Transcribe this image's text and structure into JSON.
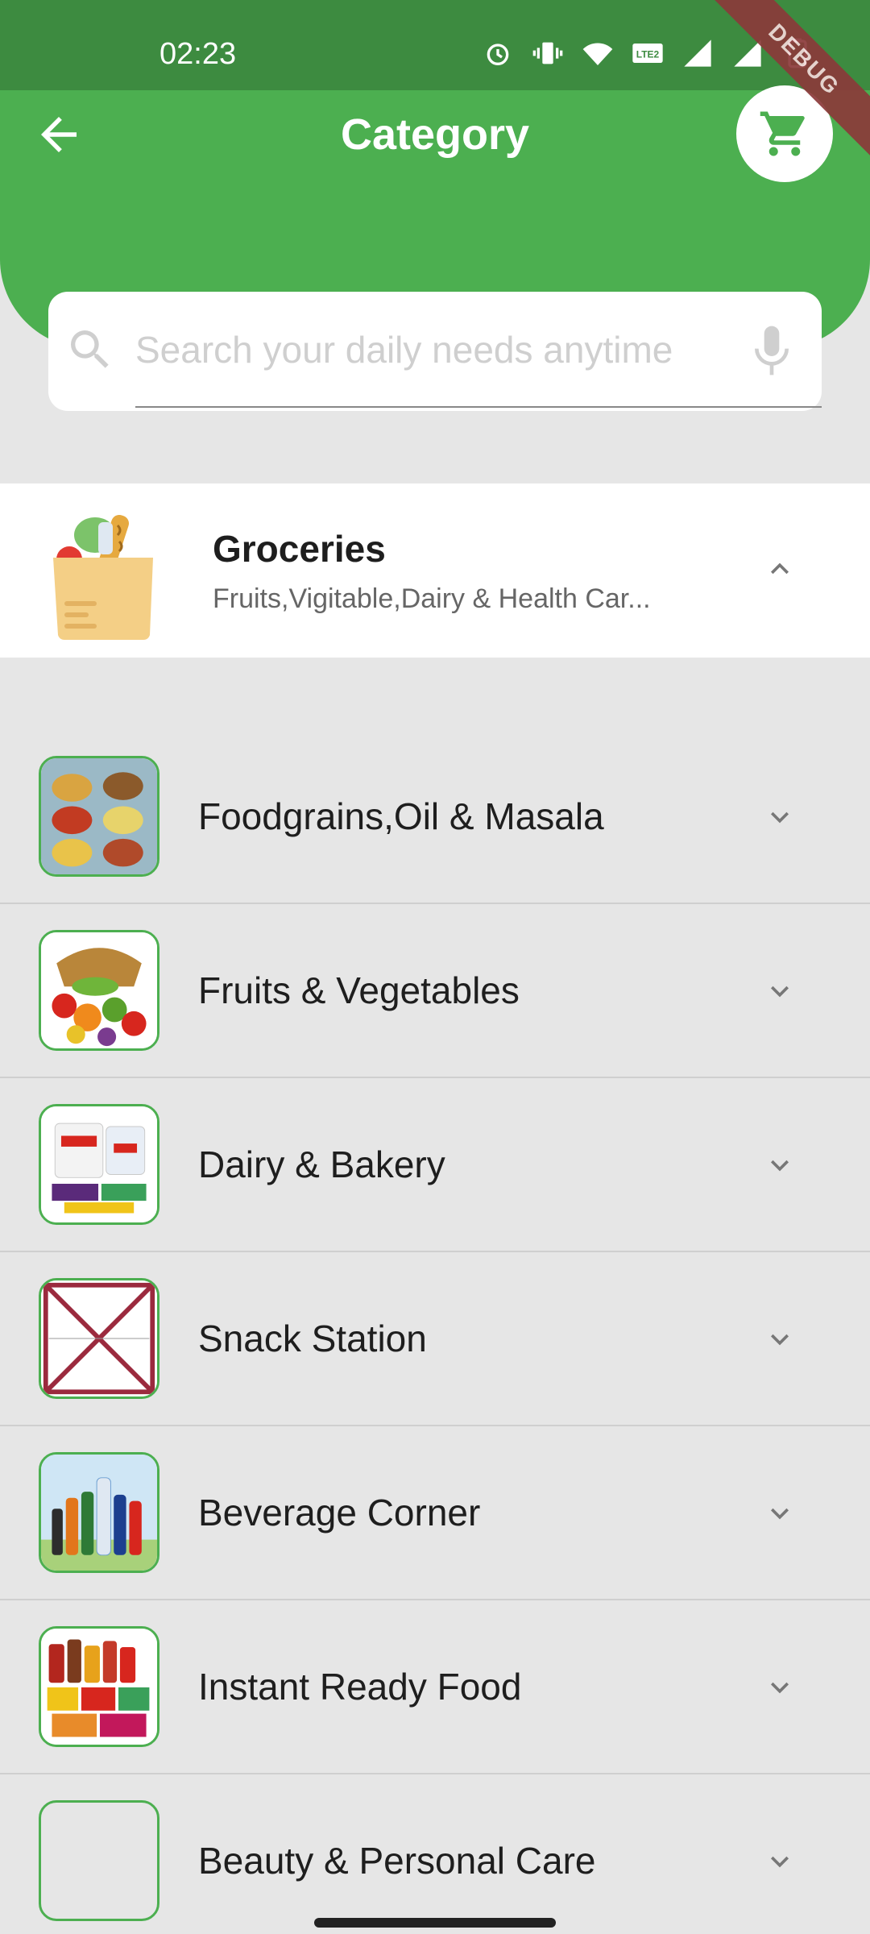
{
  "status": {
    "time": "02:23"
  },
  "debug_banner": "DEBUG",
  "header": {
    "title": "Category"
  },
  "search": {
    "placeholder": "Search your daily needs anytime",
    "value": ""
  },
  "group": {
    "title": "Groceries",
    "subtitle": "Fruits,Vigitable,Dairy & Health Car..."
  },
  "categories": [
    {
      "label": "Foodgrains,Oil & Masala"
    },
    {
      "label": "Fruits & Vegetables"
    },
    {
      "label": "Dairy & Bakery"
    },
    {
      "label": "Snack Station"
    },
    {
      "label": "Beverage Corner"
    },
    {
      "label": "Instant Ready Food"
    },
    {
      "label": "Beauty & Personal Care"
    }
  ],
  "colors": {
    "primary": "#4caf50",
    "status_bar": "#3d8b40",
    "background": "#e6e6e6"
  },
  "icons": {
    "back": "arrow-left-icon",
    "cart": "shopping-cart-icon",
    "search": "search-icon",
    "mic": "microphone-icon",
    "expand": "chevron-down-icon",
    "collapse": "chevron-up-icon"
  }
}
